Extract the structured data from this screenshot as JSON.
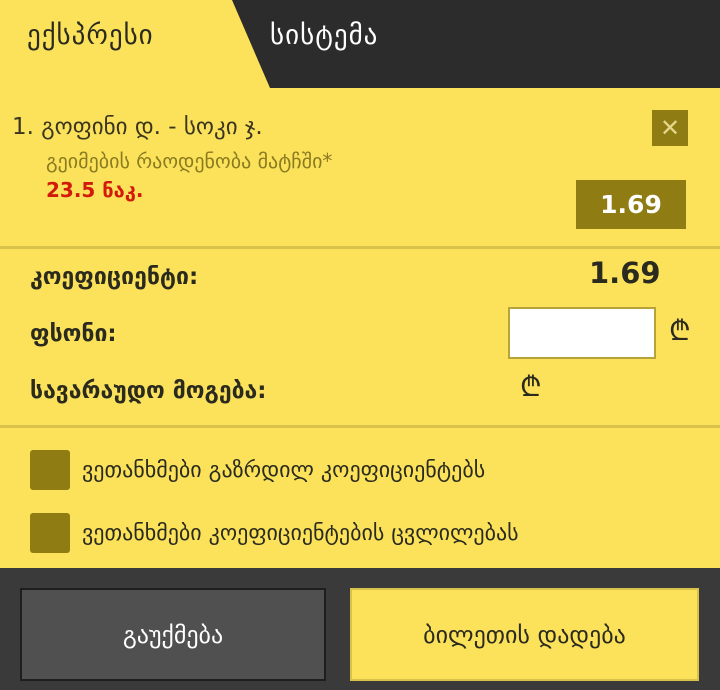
{
  "tabs": [
    {
      "label": "ექსპრესი",
      "active": true
    },
    {
      "label": "სისტემა",
      "active": false
    }
  ],
  "selection": {
    "index": "1.",
    "match": "გოფინი დ. - სოკი ჯ.",
    "market": "გეიმების რაოდენობა მატჩში*",
    "line": "23.5 ნაკ.",
    "odds": "1.69",
    "remove_icon": "close-icon"
  },
  "summary": {
    "coefficient_label": "კოეფიციენტი:",
    "coefficient_value": "1.69",
    "stake_label": "ფსონი:",
    "stake_value": "",
    "potential_win_label": "სავარაუდო მოგება:",
    "currency_symbol": "₾"
  },
  "agreements": [
    {
      "label": "ვეთანხმები გაზრდილ კოეფიციენტებს",
      "checked": false
    },
    {
      "label": "ვეთანხმები კოეფიციენტების ცვლილებას",
      "checked": false
    }
  ],
  "buttons": {
    "clear": "გაუქმება",
    "place_bet": "ბილეთის დადება"
  },
  "colors": {
    "accent": "#fbe25a",
    "dark": "#2c2c2c",
    "olive": "#8f7d14",
    "line_red": "#d21a0c"
  }
}
